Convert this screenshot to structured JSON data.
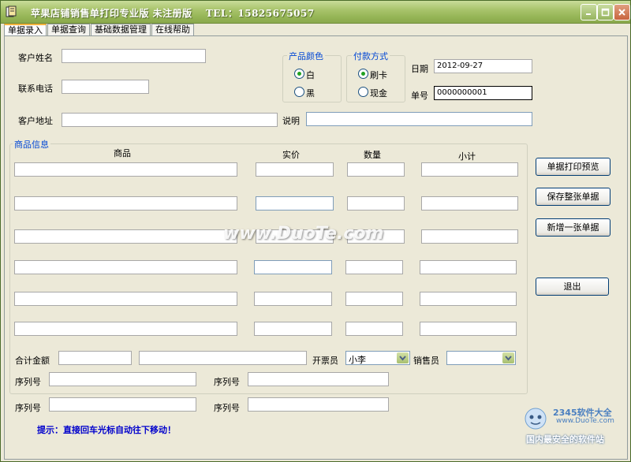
{
  "window": {
    "title": "苹果店铺销售单打印专业版 未注册版　 TEL：15825675057"
  },
  "tabs": [
    {
      "label": "单据录入"
    },
    {
      "label": "单据查询"
    },
    {
      "label": "基础数据管理"
    },
    {
      "label": "在线帮助"
    }
  ],
  "form": {
    "customer_name_label": "客户姓名",
    "customer_name_value": "",
    "phone_label": "联系电话",
    "phone_value": "",
    "address_label": "客户地址",
    "address_value": "",
    "note_label": "说明",
    "note_value": "",
    "color_group_title": "产品颜色",
    "color_options": [
      "白",
      "黑"
    ],
    "color_selected": "白",
    "payment_group_title": "付款方式",
    "payment_options": [
      "刷卡",
      "现金"
    ],
    "payment_selected": "刷卡",
    "date_label": "日期",
    "date_value": "2012-09-27",
    "number_label": "单号",
    "number_value": "0000000001"
  },
  "goods": {
    "group_title": "商品信息",
    "headers": [
      "商品",
      "实价",
      "数量",
      "小计"
    ]
  },
  "totals": {
    "total_label": "合计金额",
    "issuer_label": "开票员",
    "issuer_value": "小李",
    "seller_label": "销售员",
    "seller_value": "",
    "serial_label": "序列号"
  },
  "buttons": {
    "print_preview": "单据打印预览",
    "save": "保存整张单据",
    "new": "新增一张单据",
    "exit": "退出"
  },
  "hint": "提示：直接回车光标自动往下移动！",
  "watermarks": {
    "duote": "www.DuoTe.com",
    "site_2345": "2345软件大全",
    "site_2345_url": "www.DuoTe.com",
    "site_2345_slogan": "国内最安全的软件站"
  }
}
